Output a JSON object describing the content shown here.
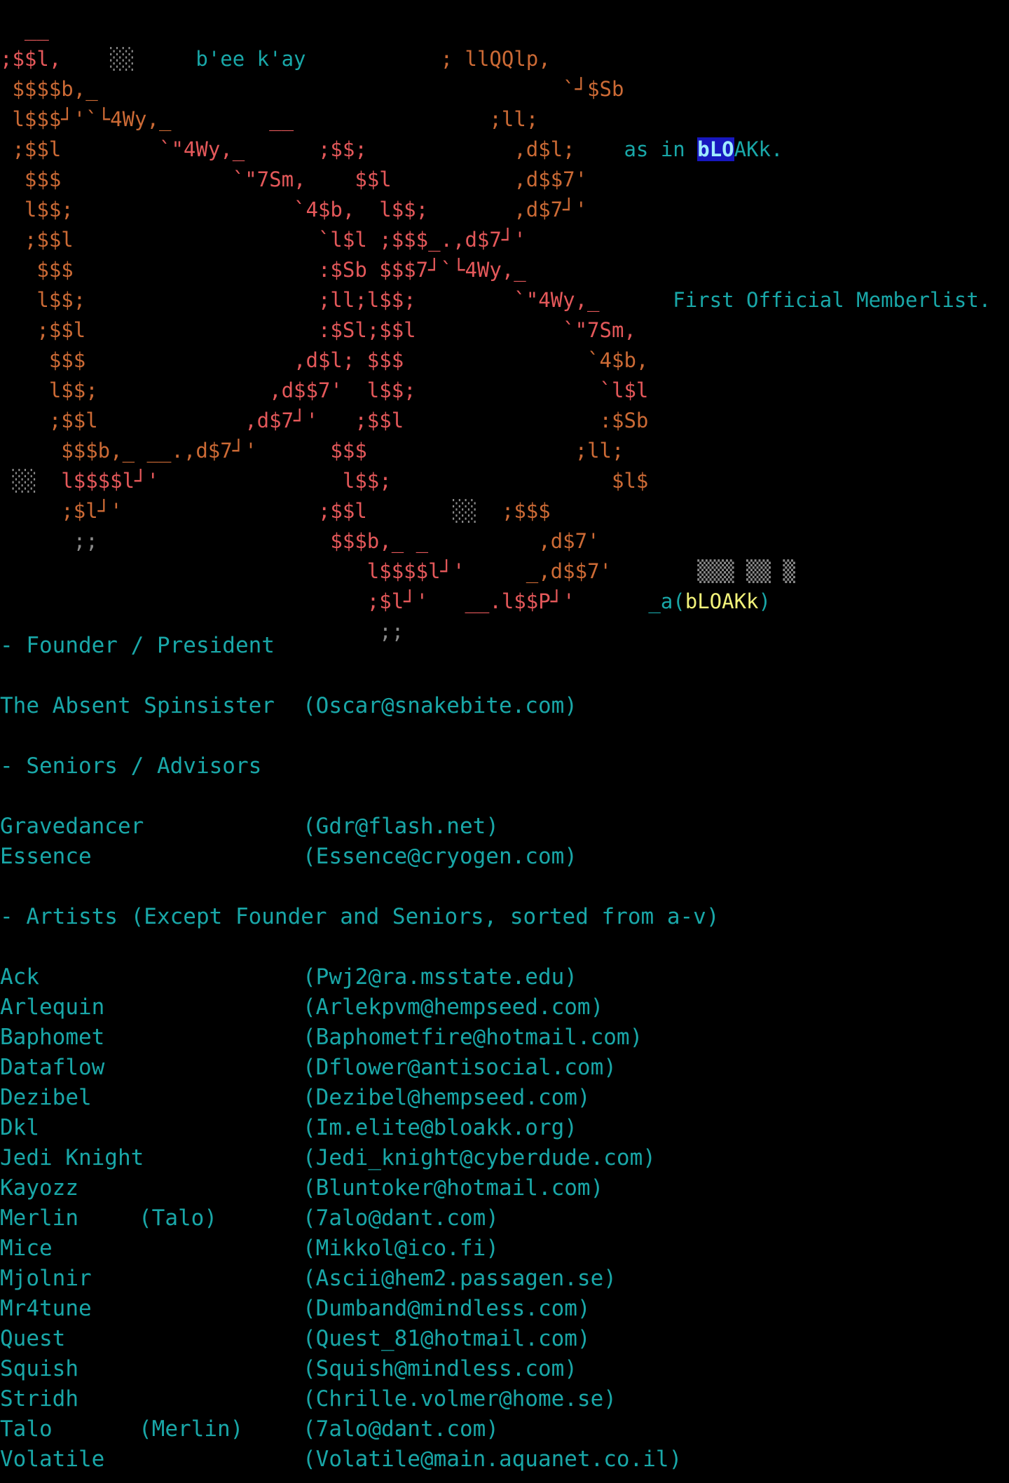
{
  "art": {
    "lines": [
      [
        {
          "t": "  __",
          "c": "rd"
        }
      ],
      [
        {
          "t": ";$$l,",
          "c": "rd"
        },
        {
          "t": "    ░░     ",
          "c": "gy"
        },
        {
          "t": "b'ee k'ay",
          "c": "cy"
        },
        {
          "t": "           ; llQQlp,",
          "c": "or"
        }
      ],
      [
        {
          "t": " $$$$b,_",
          "c": "or"
        },
        {
          "t": "                                      `┘$Sb",
          "c": "or"
        }
      ],
      [
        {
          "t": " l$$$┘'`└4Wy,_",
          "c": "or"
        },
        {
          "t": "        __",
          "c": "rd"
        },
        {
          "t": "                ;ll;",
          "c": "or"
        }
      ],
      [
        {
          "t": " ;$$l",
          "c": "or"
        },
        {
          "t": "        `\"4Wy,_      ;$$;",
          "c": "rd"
        },
        {
          "t": "            ,d$l;",
          "c": "or"
        },
        {
          "t": "    as in ",
          "c": "cy"
        },
        {
          "t": "bLO",
          "c": "hb"
        },
        {
          "t": "AKk.",
          "c": "cy"
        }
      ],
      [
        {
          "t": "  $$$",
          "c": "or"
        },
        {
          "t": "              `\"7Sm,    $$l",
          "c": "rd"
        },
        {
          "t": "          ,d$$7'",
          "c": "or"
        }
      ],
      [
        {
          "t": "  l$$;",
          "c": "or"
        },
        {
          "t": "                  `4$b,  l$$;",
          "c": "rd"
        },
        {
          "t": "       ,d$7┘'",
          "c": "or"
        }
      ],
      [
        {
          "t": "  ;$$l",
          "c": "or"
        },
        {
          "t": "                    `l$l ;$$$_.,d$7┘'",
          "c": "rd"
        }
      ],
      [
        {
          "t": "   $$$",
          "c": "or"
        },
        {
          "t": "                    :$Sb $$$7┘`└4Wy,_",
          "c": "rd"
        }
      ],
      [
        {
          "t": "   l$$;",
          "c": "or"
        },
        {
          "t": "                   ;ll;l$$;",
          "c": "rd"
        },
        {
          "t": "        `\"4Wy,_",
          "c": "rd"
        },
        {
          "t": "      First Official Memberlist.",
          "c": "cy"
        }
      ],
      [
        {
          "t": "   ;$$l",
          "c": "or"
        },
        {
          "t": "                   :$Sl;$$l",
          "c": "rd"
        },
        {
          "t": "            `\"7Sm,",
          "c": "rd"
        }
      ],
      [
        {
          "t": "    $$$",
          "c": "or"
        },
        {
          "t": "                 ,d$l; $$$",
          "c": "rd"
        },
        {
          "t": "               `4$b,",
          "c": "or"
        }
      ],
      [
        {
          "t": "    l$$;",
          "c": "or"
        },
        {
          "t": "              ,d$$7'  l$$;",
          "c": "rd"
        },
        {
          "t": "               `l$l",
          "c": "rd"
        }
      ],
      [
        {
          "t": "    ;$$l",
          "c": "or"
        },
        {
          "t": "            ,d$7┘'   ;$$l",
          "c": "rd"
        },
        {
          "t": "                :$Sb",
          "c": "or"
        }
      ],
      [
        {
          "t": "     $$$b,_ __.,d$7┘'",
          "c": "or"
        },
        {
          "t": "      $$$",
          "c": "rd"
        },
        {
          "t": "                 ;ll;",
          "c": "or"
        }
      ],
      [
        {
          "t": " ░░ ",
          "c": "gy"
        },
        {
          "t": " l$$$$l┘'",
          "c": "rd"
        },
        {
          "t": "               l$$;",
          "c": "rd"
        },
        {
          "t": "                  $l$",
          "c": "or"
        }
      ],
      [
        {
          "t": "     ;$l┘'",
          "c": "or"
        },
        {
          "t": "                ;$$l",
          "c": "rd"
        },
        {
          "t": "       ░░",
          "c": "gy"
        },
        {
          "t": "  ;$$$",
          "c": "or"
        }
      ],
      [
        {
          "t": "      ;;",
          "c": "gy"
        },
        {
          "t": "                   $$$b,_ _",
          "c": "rd"
        },
        {
          "t": "         ,d$7'",
          "c": "or"
        }
      ],
      [
        {
          "t": "                              l$$$$l┘'",
          "c": "rd"
        },
        {
          "t": "     _,d$$7'",
          "c": "or"
        },
        {
          "t": "       ▒▒▒ ▒▒ ▒",
          "c": "gy"
        }
      ],
      [
        {
          "t": "                              ;$l┘'",
          "c": "rd"
        },
        {
          "t": "   __.l$$P┘'",
          "c": "rd"
        },
        {
          "t": "      _a(",
          "c": "cy"
        },
        {
          "t": "bLOAKk",
          "c": "yl"
        },
        {
          "t": ")",
          "c": "cy"
        }
      ],
      [
        {
          "t": "                               ;;",
          "c": "gy"
        }
      ]
    ]
  },
  "sections": {
    "founder": {
      "heading": "- Founder / President",
      "members": [
        {
          "name": "The Absent Spinsister",
          "alias": "",
          "email": "(Oscar@snakebite.com)"
        }
      ]
    },
    "seniors": {
      "heading": "- Seniors / Advisors",
      "members": [
        {
          "name": "Gravedancer",
          "alias": "",
          "email": "(Gdr@flash.net)"
        },
        {
          "name": "Essence",
          "alias": "",
          "email": "(Essence@cryogen.com)"
        }
      ]
    },
    "artists": {
      "heading": "- Artists (Except Founder and Seniors, sorted from a-v)",
      "members": [
        {
          "name": "Ack",
          "alias": "",
          "email": "(Pwj2@ra.msstate.edu)"
        },
        {
          "name": "Arlequin",
          "alias": "",
          "email": "(Arlekpvm@hempseed.com)"
        },
        {
          "name": "Baphomet",
          "alias": "",
          "email": "(Baphometfire@hotmail.com)"
        },
        {
          "name": "Dataflow",
          "alias": "",
          "email": "(Dflower@antisocial.com)"
        },
        {
          "name": "Dezibel",
          "alias": "",
          "email": "(Dezibel@hempseed.com)"
        },
        {
          "name": "Dkl",
          "alias": "",
          "email": "(Im.elite@bloakk.org)"
        },
        {
          "name": "Jedi Knight",
          "alias": "",
          "email": "(Jedi_knight@cyberdude.com)"
        },
        {
          "name": "Kayozz",
          "alias": "",
          "email": "(Bluntoker@hotmail.com)"
        },
        {
          "name": "Merlin",
          "alias": "(Talo)",
          "email": "(7alo@dant.com)"
        },
        {
          "name": "Mice",
          "alias": "",
          "email": "(Mikkol@ico.fi)"
        },
        {
          "name": "Mjolnir",
          "alias": "",
          "email": "(Ascii@hem2.passagen.se)"
        },
        {
          "name": "Mr4tune",
          "alias": "",
          "email": "(Dumband@mindless.com)"
        },
        {
          "name": "Quest",
          "alias": "",
          "email": "(Quest_81@hotmail.com)"
        },
        {
          "name": "Squish",
          "alias": "",
          "email": "(Squish@mindless.com)"
        },
        {
          "name": "Stridh",
          "alias": "",
          "email": "(Chrille.volmer@home.se)"
        },
        {
          "name": "Talo",
          "alias": "(Merlin)",
          "email": "(7alo@dant.com)"
        },
        {
          "name": "Volatile",
          "alias": "",
          "email": "(Volatile@main.aquanet.co.il)"
        }
      ]
    }
  }
}
